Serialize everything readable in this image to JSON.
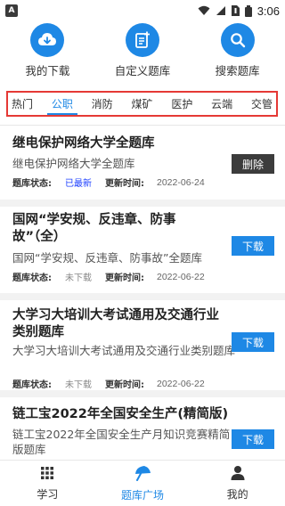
{
  "status_bar": {
    "app_icon_letter": "A",
    "time": "3:06",
    "icons": [
      "wifi-icon",
      "signal-icon",
      "sim-icon",
      "battery-icon"
    ]
  },
  "quick_actions": [
    {
      "label": "我的下载",
      "icon": "cloud-download-icon"
    },
    {
      "label": "自定义题库",
      "icon": "add-document-icon"
    },
    {
      "label": "搜索题库",
      "icon": "search-icon"
    }
  ],
  "tabs": [
    {
      "label": "热门"
    },
    {
      "label": "公职"
    },
    {
      "label": "消防"
    },
    {
      "label": "煤矿"
    },
    {
      "label": "医护"
    },
    {
      "label": "云端"
    },
    {
      "label": "交管"
    }
  ],
  "active_tab": "公职",
  "labels": {
    "status_label": "题库状态:",
    "time_label": "更新时间:"
  },
  "cards": [
    {
      "title": "继电保护网络大学全题库",
      "description": "继电保护网络大学全题库",
      "status": "已最新",
      "updated": "2022-06-24",
      "action": "删除"
    },
    {
      "title": "国网“学安规、反违章、防事故”（全）",
      "description": "国网“学安规、反违章、防事故”全题库",
      "status": "未下载",
      "updated": "2022-06-22",
      "action": "下载"
    },
    {
      "title": "大学习大培训大考试通用及交通行业类别题库",
      "description": "大学习大培训大考试通用及交通行业类别题库",
      "status": "未下载",
      "updated": "2022-06-22",
      "action": "下载"
    },
    {
      "title": "链工宝2022年全国安全生产(精简版)",
      "description": "链工宝2022年全国安全生产月知识竞赛精简版题库",
      "status": "",
      "updated": "",
      "action": "下载"
    }
  ],
  "bottom_nav": [
    {
      "label": "学习",
      "icon": "grid-icon"
    },
    {
      "label": "题库广场",
      "icon": "umbrella-icon"
    },
    {
      "label": "我的",
      "icon": "person-icon"
    }
  ],
  "active_nav": "题库广场",
  "colors": {
    "accent": "#1e88e5",
    "highlight_border": "#e53935",
    "delete_button": "#3c3c3c",
    "status_latest": "#1e40ff"
  }
}
